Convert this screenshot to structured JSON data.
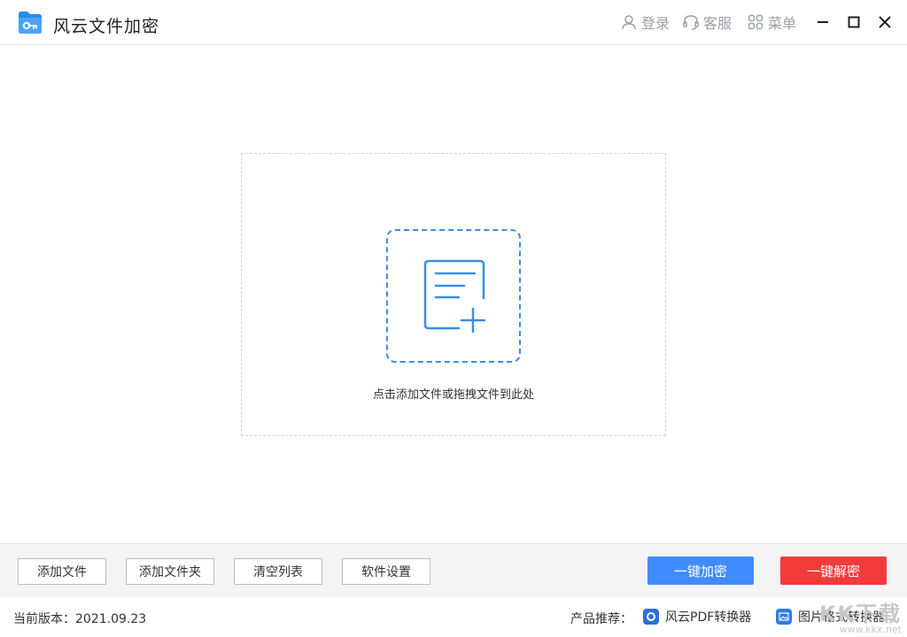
{
  "titlebar": {
    "app_title": "风云文件加密",
    "login": "登录",
    "service": "客服",
    "menu": "菜单"
  },
  "drop_zone": {
    "hint": "点击添加文件或拖拽文件到此处"
  },
  "toolbar": {
    "add_file": "添加文件",
    "add_folder": "添加文件夹",
    "clear_list": "清空列表",
    "settings": "软件设置",
    "encrypt": "一键加密",
    "decrypt": "一键解密"
  },
  "statusbar": {
    "version": "当前版本：2021.09.23",
    "recommend_label": "产品推荐：",
    "rec_pdf": "风云PDF转换器",
    "rec_image": "图片格式转换器"
  },
  "watermark": {
    "big": "KK下载",
    "small": "www.kkx.net"
  },
  "colors": {
    "accent_blue": "#3a8ee6",
    "encrypt_blue": "#3f8cff",
    "decrypt_red": "#f23b3b",
    "muted_grey": "#9aa0a6"
  }
}
